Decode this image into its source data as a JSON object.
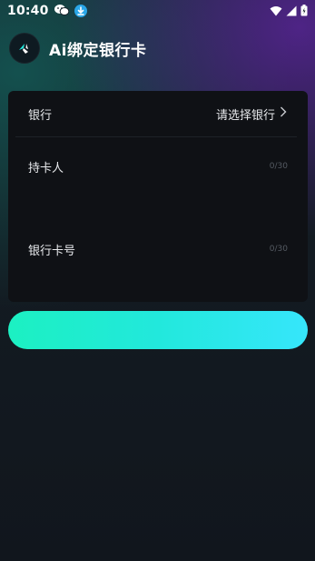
{
  "status_bar": {
    "time": "10:40"
  },
  "header": {
    "title": "Ai绑定银行卡"
  },
  "form": {
    "bank_label": "银行",
    "bank_placeholder": "请选择银行",
    "holder_label": "持卡人",
    "holder_counter": "0/30",
    "card_number_label": "银行卡号",
    "card_number_counter": "0/30"
  },
  "submit": {
    "label": ""
  },
  "colors": {
    "accent_start": "#1cf0c2",
    "accent_end": "#36e6fb",
    "card_bg": "#0f1115"
  }
}
